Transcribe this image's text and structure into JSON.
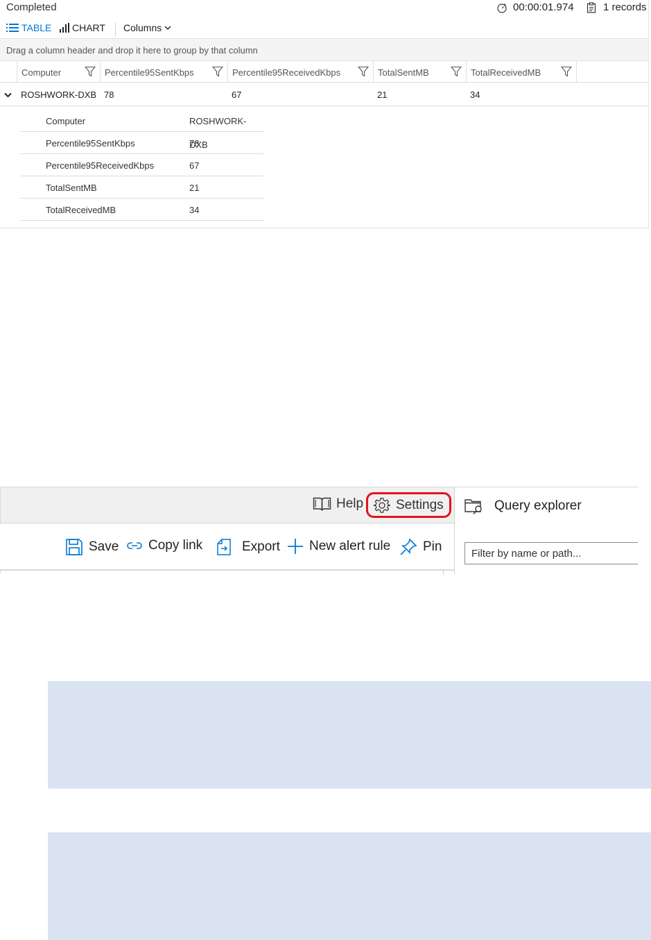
{
  "results": {
    "status": "Completed",
    "elapsed": "00:00:01.974",
    "records": "1 records",
    "tabs": [
      {
        "label": "TABLE",
        "icon": "list-icon",
        "active": true
      },
      {
        "label": "CHART",
        "icon": "bar-chart-icon",
        "active": false
      }
    ],
    "columns_label": "Columns",
    "group_hint": "Drag a column header and drop it here to group by that column",
    "headers": [
      "Computer",
      "Percentile95SentKbps",
      "Percentile95ReceivedKbps",
      "TotalSentMB",
      "TotalReceivedMB"
    ],
    "row": [
      "ROSHWORK-DXB",
      "78",
      "67",
      "21",
      "34"
    ],
    "detail": [
      {
        "key": "Computer",
        "value": "ROSHWORK-DXB"
      },
      {
        "key": "Percentile95SentKbps",
        "value": "78"
      },
      {
        "key": "Percentile95ReceivedKbps",
        "value": "67"
      },
      {
        "key": "TotalSentMB",
        "value": "21"
      },
      {
        "key": "TotalReceivedMB",
        "value": "34"
      }
    ]
  },
  "toolbar": {
    "help": "Help",
    "settings": "Settings",
    "save": "Save",
    "copy_link": "Copy link",
    "export": "Export",
    "new_alert_rule": "New alert rule",
    "pin": "Pin",
    "highlight_color": "#e0151b",
    "accent_color": "#0078d4"
  },
  "explorer": {
    "title": "Query explorer",
    "filter_placeholder": "Filter by name or path..."
  },
  "callout_color": "#d9e3f2"
}
